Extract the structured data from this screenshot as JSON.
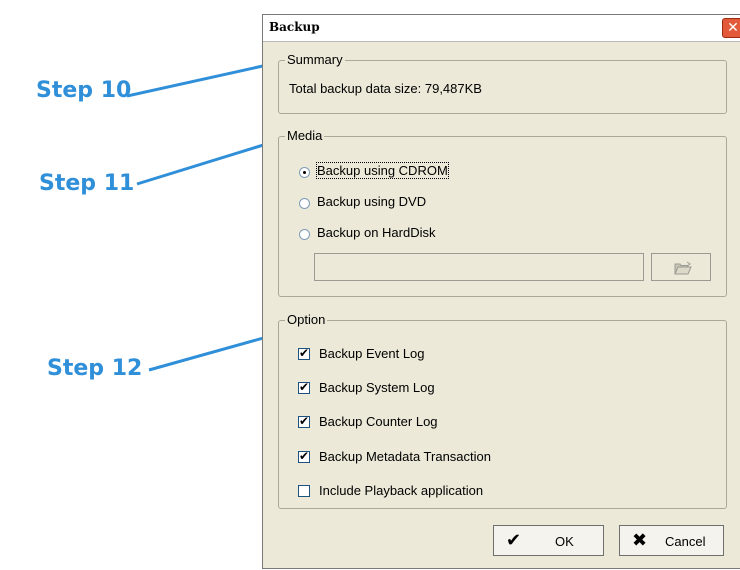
{
  "callouts": {
    "step10": "Step 10",
    "step11": "Step 11",
    "step12": "Step 12",
    "line_color": "#2f8fd8"
  },
  "dialog": {
    "title": "Backup",
    "close_glyph": "✕",
    "summary": {
      "legend": "Summary",
      "text": "Total backup data size: 79,487KB"
    },
    "media": {
      "legend": "Media",
      "options": [
        {
          "label": "Backup using CDROM",
          "selected": true
        },
        {
          "label": "Backup using DVD",
          "selected": false
        },
        {
          "label": "Backup on HardDisk",
          "selected": false
        }
      ],
      "path_value": "",
      "browse_icon": "folder-open-icon"
    },
    "option": {
      "legend": "Option",
      "items": [
        {
          "label": "Backup Event Log",
          "checked": true
        },
        {
          "label": "Backup System Log",
          "checked": true
        },
        {
          "label": "Backup Counter Log",
          "checked": true
        },
        {
          "label": "Backup Metadata Transaction",
          "checked": true
        },
        {
          "label": "Include Playback application",
          "checked": false
        }
      ]
    },
    "buttons": {
      "ok": "OK",
      "cancel": "Cancel"
    }
  }
}
